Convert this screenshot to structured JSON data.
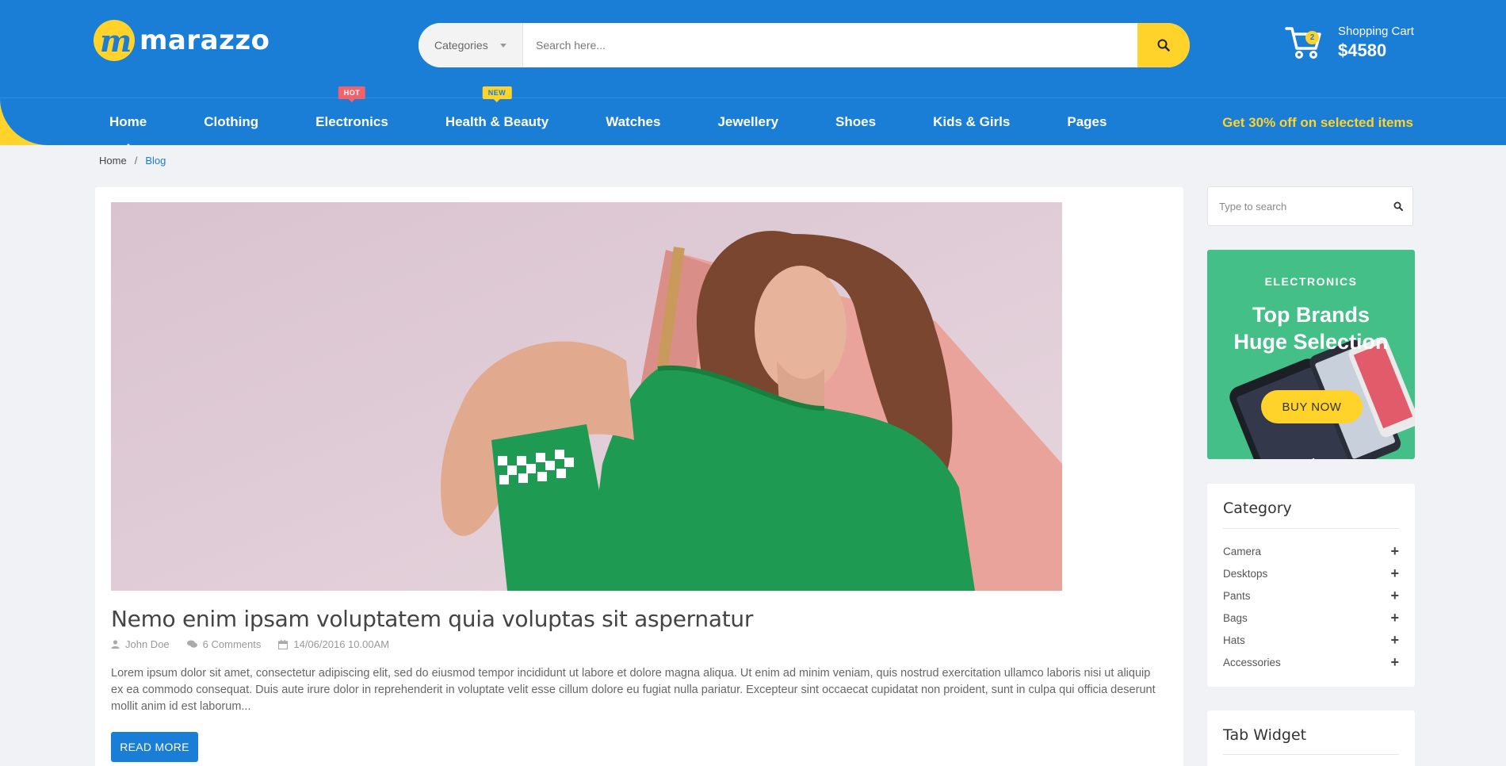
{
  "brand": {
    "name": "marazzo",
    "mark": "m"
  },
  "search": {
    "category_label": "Categories",
    "placeholder": "Search here..."
  },
  "cart": {
    "label": "Shopping Cart",
    "amount": "$4580",
    "count": "2"
  },
  "nav": {
    "items": [
      {
        "label": "Home",
        "active": true
      },
      {
        "label": "Clothing"
      },
      {
        "label": "Electronics",
        "badge": "HOT"
      },
      {
        "label": "Health & Beauty",
        "badge": "NEW"
      },
      {
        "label": "Watches"
      },
      {
        "label": "Jewellery"
      },
      {
        "label": "Shoes"
      },
      {
        "label": "Kids & Girls"
      },
      {
        "label": "Pages"
      }
    ],
    "promo": "Get 30% off on selected items"
  },
  "breadcrumb": {
    "home": "Home",
    "separator": "/",
    "current": "Blog"
  },
  "post": {
    "title": "Nemo enim ipsam voluptatem quia voluptas sit aspernatur",
    "author": "John Doe",
    "comments": "6 Comments",
    "date": "14/06/2016 10.00AM",
    "excerpt": "Lorem ipsum dolor sit amet, consectetur adipiscing elit, sed do eiusmod tempor incididunt ut labore et dolore magna aliqua. Ut enim ad minim veniam, quis nostrud exercitation ullamco laboris nisi ut aliquip ex ea commodo consequat. Duis aute irure dolor in reprehenderit in voluptate velit esse cillum dolore eu fugiat nulla pariatur. Excepteur sint occaecat cupidatat non proident, sunt in culpa qui officia deserunt mollit anim id est laborum...",
    "read_more": "READ MORE"
  },
  "sidebar": {
    "search_placeholder": "Type to search",
    "banner": {
      "eyebrow": "ELECTRONICS",
      "line1": "Top Brands",
      "line2": "Huge Selection",
      "cta": "BUY NOW"
    },
    "category": {
      "title": "Category",
      "items": [
        "Camera",
        "Desktops",
        "Pants",
        "Bags",
        "Hats",
        "Accessories"
      ]
    },
    "tab_widget": {
      "title": "Tab Widget"
    }
  },
  "colors": {
    "primary": "#1a7dd6",
    "accent": "#ffd32a",
    "hot": "#f3626b",
    "banner": "#43bf87"
  }
}
